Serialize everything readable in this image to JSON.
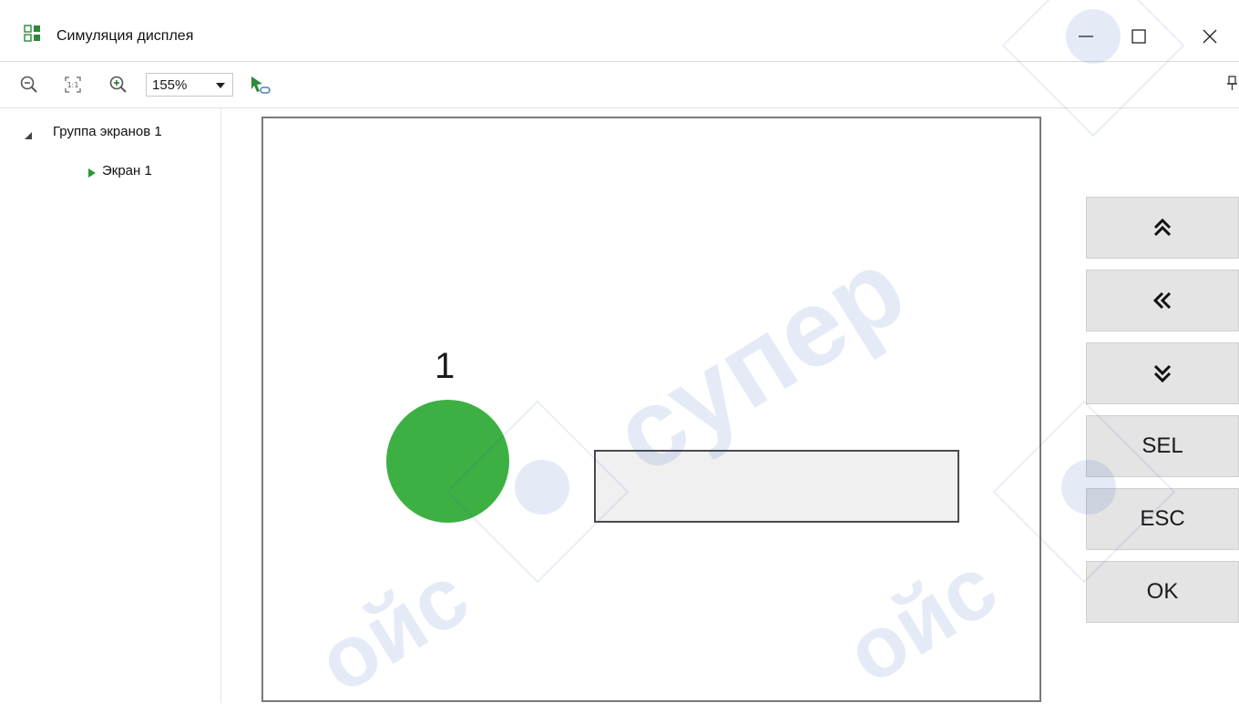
{
  "window": {
    "title": "Симуляция дисплея",
    "accent_green": "#3cb043"
  },
  "toolbar": {
    "zoom_out_icon": "zoom-out-icon",
    "actual_size_icon": "actual-size-icon",
    "zoom_in_icon": "zoom-in-icon",
    "zoom_value": "155%",
    "run_icon": "run-link-icon"
  },
  "tree": {
    "group_label": "Группа экранов 1",
    "screen_label": "Экран 1"
  },
  "screen": {
    "lamp_label": "1",
    "lamp_color": "#3db044",
    "value_field_text": ""
  },
  "keys": [
    {
      "label": "",
      "icon": "double-chevron-up-icon"
    },
    {
      "label": "",
      "icon": "double-chevron-left-icon"
    },
    {
      "label": "",
      "icon": "double-chevron-down-icon"
    },
    {
      "label": "SEL"
    },
    {
      "label": "ESC"
    },
    {
      "label": "OK"
    }
  ],
  "watermark": {
    "text_1": "сyпеp",
    "text_2": "ойс"
  }
}
